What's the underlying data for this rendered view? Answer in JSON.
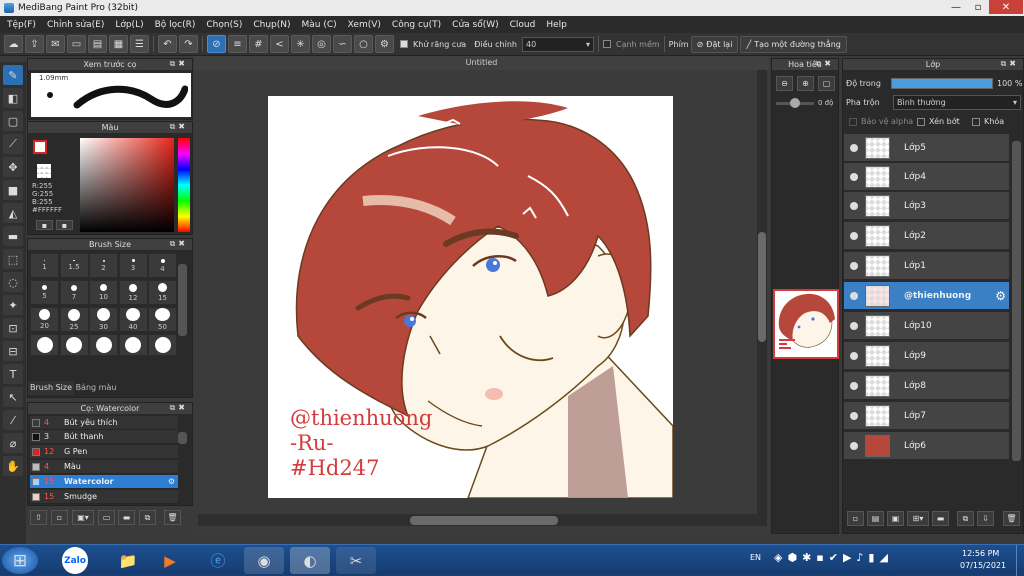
{
  "window": {
    "title": "MediBang Paint Pro (32bit)"
  },
  "menu": [
    "Tệp(F)",
    "Chỉnh sửa(E)",
    "Lớp(L)",
    "Bộ lọc(R)",
    "Chọn(S)",
    "Chụp(N)",
    "Màu (C)",
    "Xem(V)",
    "Công cụ(T)",
    "Cửa sổ(W)",
    "Cloud",
    "Help"
  ],
  "toolbar": {
    "antialias_label": "Khử răng cưa",
    "adjust_label": "Điều chỉnh",
    "adjust_value": "40",
    "edge_label": "Cạnh mềm",
    "key_label": "Phím",
    "reset_label": "Đặt lại",
    "straight_label": "Tạo một đường thẳng"
  },
  "preview": {
    "title": "Xem trước cọ",
    "size": "1.09mm"
  },
  "color": {
    "title": "Màu",
    "r": "R:255",
    "g": "G:255",
    "b": "B:255",
    "hex": "#FFFFFF"
  },
  "brushsize": {
    "title": "Brush Size",
    "sizes": [
      "1",
      "1.5",
      "2",
      "3",
      "4",
      "5",
      "7",
      "10",
      "12",
      "15",
      "20",
      "25",
      "30",
      "40",
      "50"
    ],
    "tab1": "Brush Size",
    "tab2": "Bảng màu"
  },
  "brushes": {
    "title": "Cọ: Watercolor",
    "items": [
      {
        "size": "4",
        "name": "Bút yêu thích",
        "color": "#3a3a3a"
      },
      {
        "size": "3",
        "name": "Bút thanh",
        "color": "#111111"
      },
      {
        "size": "12",
        "name": "G Pen",
        "color": "#e02020"
      },
      {
        "size": "4",
        "name": "Màu",
        "color": "#bbbbbb"
      },
      {
        "size": "15",
        "name": "Watercolor",
        "color": "#9fd3ff"
      },
      {
        "size": "15",
        "name": "Smudge",
        "color": "#f0d0c0"
      }
    ]
  },
  "document": {
    "tab": "Untitled",
    "watermark_line1": "@thienhuong",
    "watermark_line2": "-Ru-",
    "watermark_line3": "#Hd247"
  },
  "navigator": {
    "title": "Hoa tiêu",
    "angle": "0 độ"
  },
  "layers": {
    "title": "Lớp",
    "opacity_label": "Độ trong",
    "opacity_value": "100 %",
    "blend_label": "Pha trộn",
    "blend_value": "Bình thường",
    "protect_label": "Bảo vệ alpha",
    "clip_label": "Xén bớt",
    "lock_label": "Khóa",
    "items": [
      "Lớp5",
      "Lớp4",
      "Lớp3",
      "Lớp2",
      "Lớp1",
      "@thienhuong",
      "Lớp10",
      "Lớp9",
      "Lớp8",
      "Lớp7",
      "Lớp6"
    ]
  },
  "taskbar": {
    "lang": "EN",
    "time": "12:56 PM",
    "date": "07/15/2021",
    "zalo": "Zalo"
  },
  "colors": {
    "accent": "#3b7fc4",
    "hair": "#b5483a",
    "skin": "#fdf6e8",
    "eye": "#4a78d8",
    "watermark": "#d23c3c"
  }
}
